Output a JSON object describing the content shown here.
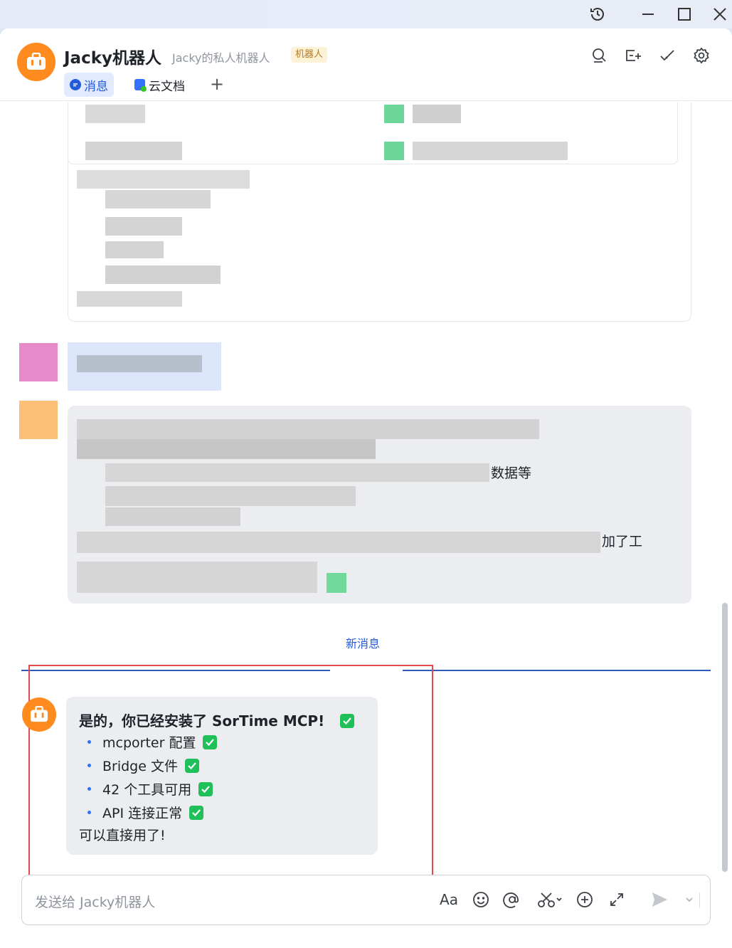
{
  "window": {
    "title_icons": [
      "history-icon",
      "minimize-icon",
      "maximize-icon",
      "close-icon"
    ]
  },
  "header": {
    "title": "Jacky机器人",
    "subtitle": "Jacky的私人机器人",
    "badge": "机器人",
    "actions": [
      "search-icon",
      "add-to-screen-icon",
      "checkmark-icon",
      "gear-icon"
    ],
    "tabs": [
      {
        "label": "消息",
        "active": true
      },
      {
        "label": "云文档",
        "active": false
      }
    ],
    "add_tab": "+"
  },
  "chat": {
    "previous_fragments": [
      "数据等",
      "加了工"
    ],
    "divider": "新消息",
    "message": {
      "title": "是的，你已经安装了 SorTime MCP!",
      "items": [
        "mcporter 配置",
        "Bridge 文件",
        "42 个工具可用",
        "API 连接正常"
      ],
      "closing": "可以直接用了!"
    }
  },
  "composer": {
    "placeholder": "发送给 Jacky机器人",
    "tools": [
      "format-icon",
      "emoji-icon",
      "mention-icon",
      "screenshot-icon",
      "plus-circle-icon",
      "expand-icon",
      "send-icon",
      "chevron-down-icon"
    ],
    "format_label": "Aa"
  },
  "colors": {
    "accent": "#245bdb",
    "bot_orange": "#ff8a1e",
    "highlight_red": "#e5484d",
    "check_green": "#1fbf5a"
  }
}
